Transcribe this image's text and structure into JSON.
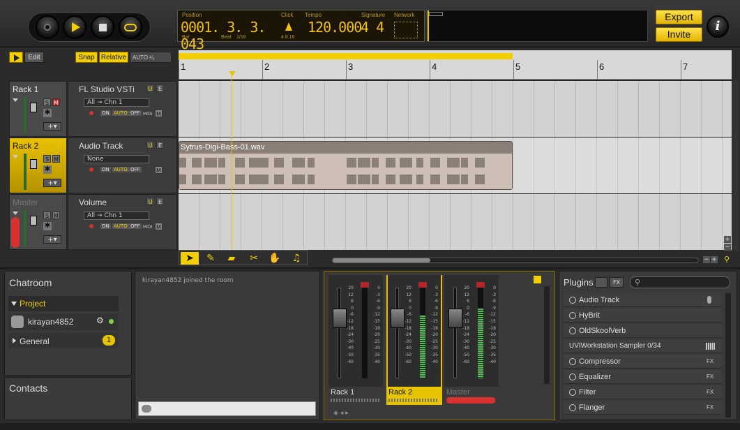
{
  "transport": {
    "stop_icon": "record-icon",
    "play_icon": "play-icon",
    "stop2_icon": "stop-icon",
    "loop_icon": "loop-icon"
  },
  "lcd": {
    "position_label": "Position",
    "position_value": "0001. 3. 3. 043",
    "bar_label": "Bar",
    "beat_label": "Beat",
    "beat_div": "1/16",
    "click_label": "Click",
    "click_sub": "4 8 16",
    "tempo_label": "Tempo",
    "tempo_value": "120.000",
    "signature_label": "Signature",
    "signature_value": "4 4",
    "network_label": "Network"
  },
  "top_buttons": {
    "export": "Export",
    "invite": "Invite",
    "info": "i"
  },
  "toolbar": {
    "edit": "Edit",
    "snap": "Snap",
    "relative": "Relative",
    "auto": "AUTO ¹⁄₈"
  },
  "ruler": {
    "bars": [
      "1",
      "2",
      "3",
      "4",
      "5",
      "6",
      "7"
    ]
  },
  "tracks": [
    {
      "name": "Rack 1",
      "device": "FL Studio VSTi",
      "routing": "All → Chn 1",
      "midi": "MIDI"
    },
    {
      "name": "Rack 2",
      "device": "Audio Track",
      "routing": "None",
      "midi": ""
    },
    {
      "name": "Master",
      "device": "Volume",
      "routing": "All → Chn 1",
      "midi": "MIDI"
    }
  ],
  "track_buttons": {
    "s": "S",
    "m": "M",
    "on": "ON",
    "auto": "AUTO",
    "off": "OFF",
    "mixer_m": "M",
    "u": "U",
    "e": "E"
  },
  "clip": {
    "name": "Sytrus-Digi-Bass-01.wav"
  },
  "chat": {
    "title": "Chatroom",
    "project_label": "Project",
    "user": "kirayan4852",
    "general_label": "General",
    "general_count": "1",
    "message": "kirayan4852 joined the room",
    "contacts_title": "Contacts"
  },
  "mixer": {
    "channels": [
      "Rack 1",
      "Rack 2",
      "Master"
    ],
    "scale_left": [
      "20",
      "12",
      "6",
      "0",
      "-6",
      "-12",
      "-18",
      "-24",
      "-30",
      "-40",
      "-50",
      "-60"
    ],
    "scale_right": [
      "0",
      "-3",
      "-6",
      "-9",
      "-12",
      "-15",
      "-18",
      "-20",
      "-25",
      "-30",
      "-35",
      "-40"
    ]
  },
  "plugins": {
    "title": "Plugins",
    "fx_btn": "FX",
    "items": [
      {
        "name": "Audio Track",
        "tag": ""
      },
      {
        "name": "HyBrit",
        "tag": ""
      },
      {
        "name": "OldSkoolVerb",
        "tag": ""
      },
      {
        "name": "UVIWorkstation Sampler 0/34",
        "tag": ""
      },
      {
        "name": "Compressor",
        "tag": "FX"
      },
      {
        "name": "Equalizer",
        "tag": "FX"
      },
      {
        "name": "Filter",
        "tag": "FX"
      },
      {
        "name": "Flanger",
        "tag": "FX"
      }
    ]
  },
  "colors": {
    "accent": "#f3cf00",
    "lcd_text": "#f3c20e"
  }
}
